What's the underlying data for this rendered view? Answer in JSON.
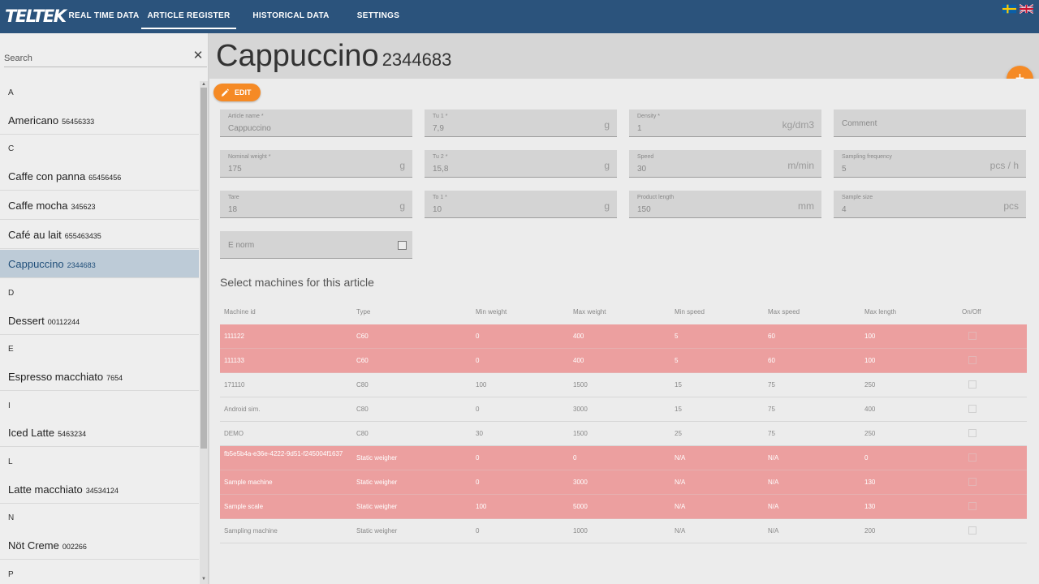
{
  "app": {
    "logo": "TELTEK"
  },
  "nav": {
    "tabs": [
      {
        "label": "REAL TIME DATA"
      },
      {
        "label": "ARTICLE REGISTER",
        "active": true
      },
      {
        "label": "HISTORICAL DATA"
      },
      {
        "label": "SETTINGS"
      }
    ],
    "flags": [
      "swedish-flag-icon",
      "uk-flag-icon"
    ]
  },
  "sidebar": {
    "search_placeholder": "Search",
    "clear_icon": "close-icon",
    "clear_glyph": "✕",
    "letters": [
      "A",
      "C",
      "D",
      "E",
      "I",
      "L",
      "N",
      "P"
    ],
    "items": [
      {
        "name": "Americano",
        "code": "56456333"
      },
      {
        "name": "Caffe con panna",
        "code": "65456456"
      },
      {
        "name": "Caffe mocha",
        "code": "345623"
      },
      {
        "name": "Café au lait",
        "code": "655463435"
      },
      {
        "name": "Cappuccino",
        "code": "2344683",
        "selected": true
      },
      {
        "name": "Dessert",
        "code": "00112244"
      },
      {
        "name": "Espresso macchiato",
        "code": "7654"
      },
      {
        "name": "Iced Latte",
        "code": "5463234"
      },
      {
        "name": "Latte macchiato",
        "code": "34534124"
      },
      {
        "name": "Nöt Creme",
        "code": "002266"
      }
    ]
  },
  "main": {
    "title": "Cappuccino",
    "code": "2344683",
    "edit_label": "EDIT",
    "add_glyph": "+",
    "fields": {
      "article_name": {
        "label": "Article name *",
        "value": "Cappuccino",
        "unit": ""
      },
      "tu1": {
        "label": "Tu 1 *",
        "value": "7,9",
        "unit": "g"
      },
      "density": {
        "label": "Density *",
        "value": "1",
        "unit": "kg/dm3"
      },
      "comment": {
        "placeholder": "Comment"
      },
      "nominal_weight": {
        "label": "Nominal weight *",
        "value": "175",
        "unit": "g"
      },
      "tu2": {
        "label": "Tu 2 *",
        "value": "15,8",
        "unit": "g"
      },
      "speed": {
        "label": "Speed",
        "value": "30",
        "unit": "m/min"
      },
      "sampling_frequency": {
        "label": "Sampling frequency",
        "value": "5",
        "unit": "pcs / h"
      },
      "tare": {
        "label": "Tare",
        "value": "18",
        "unit": "g"
      },
      "to1": {
        "label": "To 1 *",
        "value": "10",
        "unit": "g"
      },
      "product_length": {
        "label": "Product length",
        "value": "150",
        "unit": "mm"
      },
      "sample_size": {
        "label": "Sample size",
        "value": "4",
        "unit": "pcs"
      },
      "e_norm": {
        "label": "E norm"
      }
    },
    "machines_title": "Select machines for this article",
    "machines": {
      "columns": [
        "Machine id",
        "Type",
        "Min weight",
        "Max weight",
        "Min speed",
        "Max speed",
        "Max length",
        "On/Off"
      ],
      "rows": [
        {
          "id": "111122",
          "type": "C60",
          "min_weight": "0",
          "max_weight": "400",
          "min_speed": "5",
          "max_speed": "60",
          "max_length": "100",
          "highlighted": true
        },
        {
          "id": "111133",
          "type": "C60",
          "min_weight": "0",
          "max_weight": "400",
          "min_speed": "5",
          "max_speed": "60",
          "max_length": "100",
          "highlighted": true
        },
        {
          "id": "171110",
          "type": "C80",
          "min_weight": "100",
          "max_weight": "1500",
          "min_speed": "15",
          "max_speed": "75",
          "max_length": "250",
          "highlighted": false
        },
        {
          "id": "Android sim.",
          "type": "C80",
          "min_weight": "0",
          "max_weight": "3000",
          "min_speed": "15",
          "max_speed": "75",
          "max_length": "400",
          "highlighted": false
        },
        {
          "id": "DEMO",
          "type": "C80",
          "min_weight": "30",
          "max_weight": "1500",
          "min_speed": "25",
          "max_speed": "75",
          "max_length": "250",
          "highlighted": false
        },
        {
          "id": "fb5e5b4a-e36e-4222-9d51-f245004f1637",
          "type": "Static weigher",
          "min_weight": "0",
          "max_weight": "0",
          "min_speed": "N/A",
          "max_speed": "N/A",
          "max_length": "0",
          "highlighted": true
        },
        {
          "id": "Sample machine",
          "type": "Static weigher",
          "min_weight": "0",
          "max_weight": "3000",
          "min_speed": "N/A",
          "max_speed": "N/A",
          "max_length": "130",
          "highlighted": true
        },
        {
          "id": "Sample scale",
          "type": "Static weigher",
          "min_weight": "100",
          "max_weight": "5000",
          "min_speed": "N/A",
          "max_speed": "N/A",
          "max_length": "130",
          "highlighted": true
        },
        {
          "id": "Sampling machine",
          "type": "Static weigher",
          "min_weight": "0",
          "max_weight": "1000",
          "min_speed": "N/A",
          "max_speed": "N/A",
          "max_length": "200",
          "highlighted": false
        }
      ]
    }
  },
  "colors": {
    "topbar": "#2b537c",
    "accent": "#f58a25",
    "row_highlight": "#ec9f9f",
    "selected_item": "#bdcbd7"
  }
}
